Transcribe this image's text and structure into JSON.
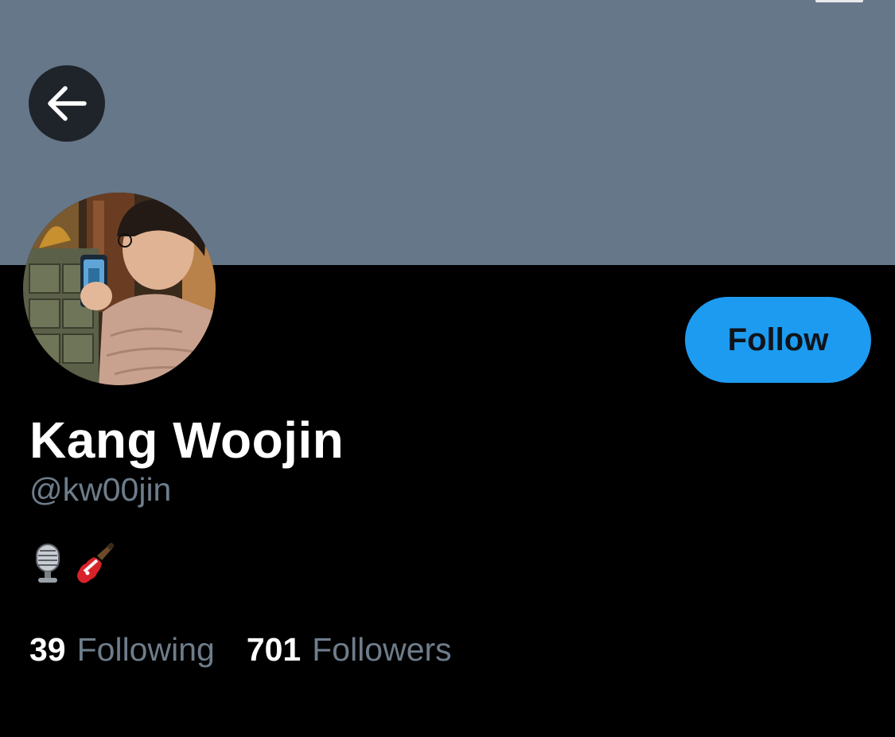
{
  "profile": {
    "display_name": "Kang Woojin",
    "handle": "@kw00jin",
    "bio_icons": [
      "microphone-icon",
      "guitar-icon"
    ]
  },
  "actions": {
    "follow_label": "Follow"
  },
  "stats": {
    "following_count": "39",
    "following_label": "Following",
    "followers_count": "701",
    "followers_label": "Followers"
  },
  "colors": {
    "banner": "#66778a",
    "accent": "#1d9bf0",
    "secondary_text": "#6e7d8b",
    "background": "#000000"
  }
}
